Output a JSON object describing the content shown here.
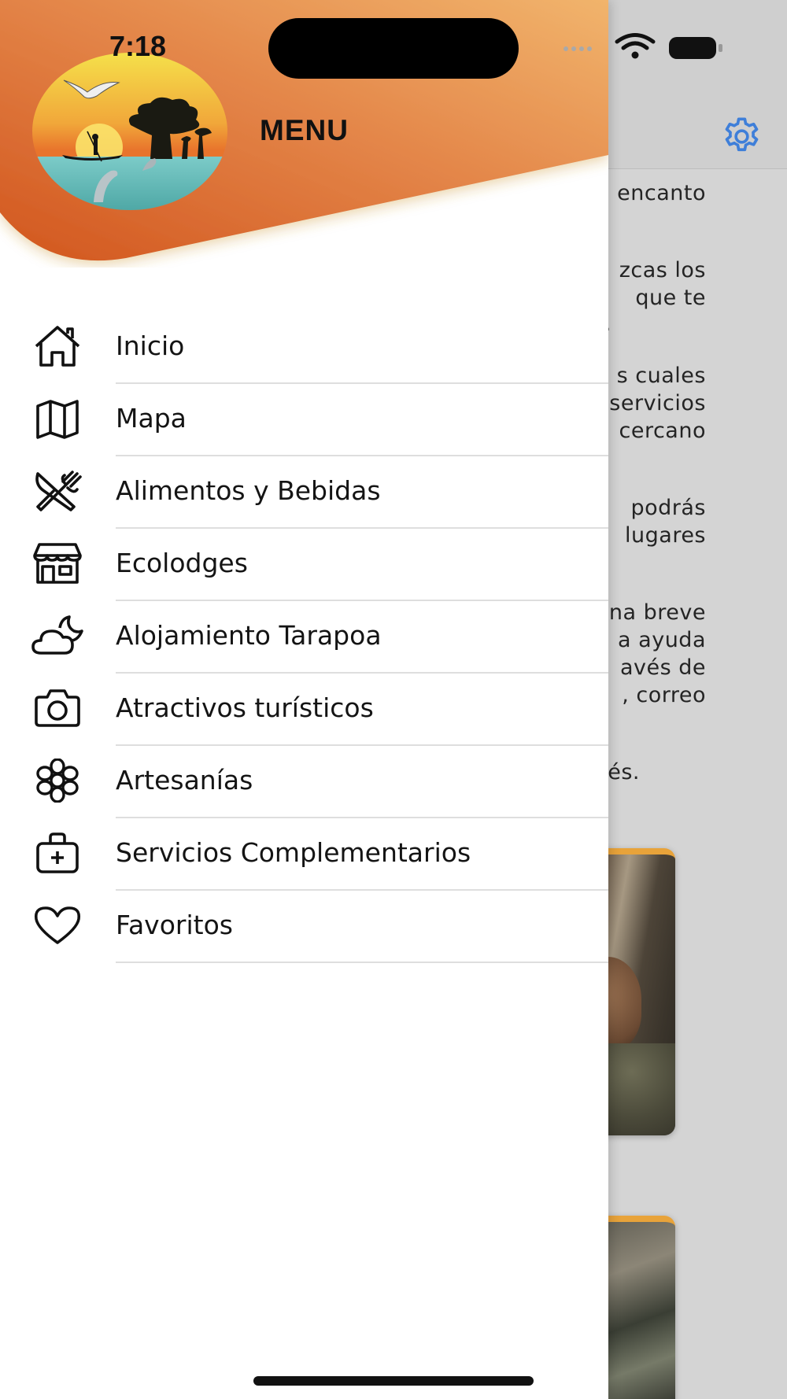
{
  "status_bar": {
    "time": "7:18"
  },
  "drawer": {
    "title": "MENU",
    "accent_colors": {
      "header_start": "#d2561e",
      "header_end": "#f1b46c"
    },
    "items": [
      {
        "label": "Inicio",
        "icon": "home-icon"
      },
      {
        "label": "Mapa",
        "icon": "map-icon"
      },
      {
        "label": "Alimentos y Bebidas",
        "icon": "utensils-icon"
      },
      {
        "label": "Ecolodges",
        "icon": "store-icon"
      },
      {
        "label": "Alojamiento Tarapoa",
        "icon": "moon-cloud-icon"
      },
      {
        "label": "Atractivos turísticos",
        "icon": "camera-icon"
      },
      {
        "label": "Artesanías",
        "icon": "flower-icon"
      },
      {
        "label": "Servicios Complementarios",
        "icon": "medkit-icon"
      },
      {
        "label": "Favoritos",
        "icon": "heart-icon"
      }
    ]
  },
  "background_page": {
    "text_fragments": [
      "encanto",
      "zcas los",
      "que te",
      ".",
      "s cuales",
      "servicios",
      "cercano",
      "podrás",
      "lugares",
      "na breve",
      "a ayuda",
      "avés de",
      ", correo",
      "és."
    ],
    "settings_icon": "gear-icon",
    "accent_color": "#3f7fd9"
  }
}
